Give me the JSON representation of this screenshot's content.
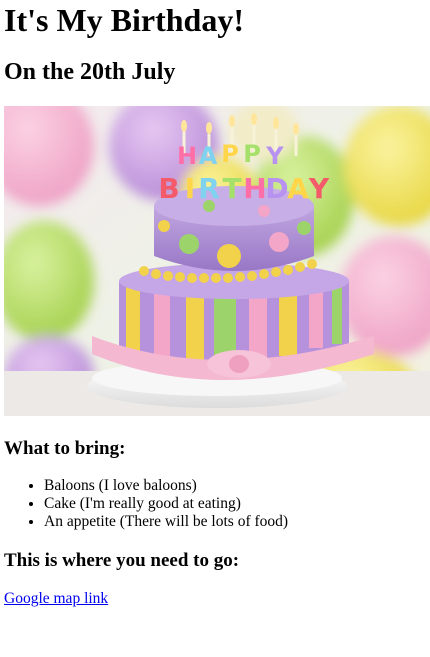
{
  "page": {
    "title": "It's My Birthday!",
    "subtitle": "On the 20th July"
  },
  "image": {
    "cake_text": "HAPPY BIRTHDAY"
  },
  "bring": {
    "heading": "What to bring:",
    "items": [
      "Baloons (I love baloons)",
      "Cake (I'm really good at eating)",
      "An appetite (There will be lots of food)"
    ]
  },
  "location": {
    "heading": "This is where you need to go:",
    "link_text": "Google map link"
  },
  "colors": {
    "link": "#0000ee",
    "text": "#000000",
    "background": "#ffffff"
  }
}
